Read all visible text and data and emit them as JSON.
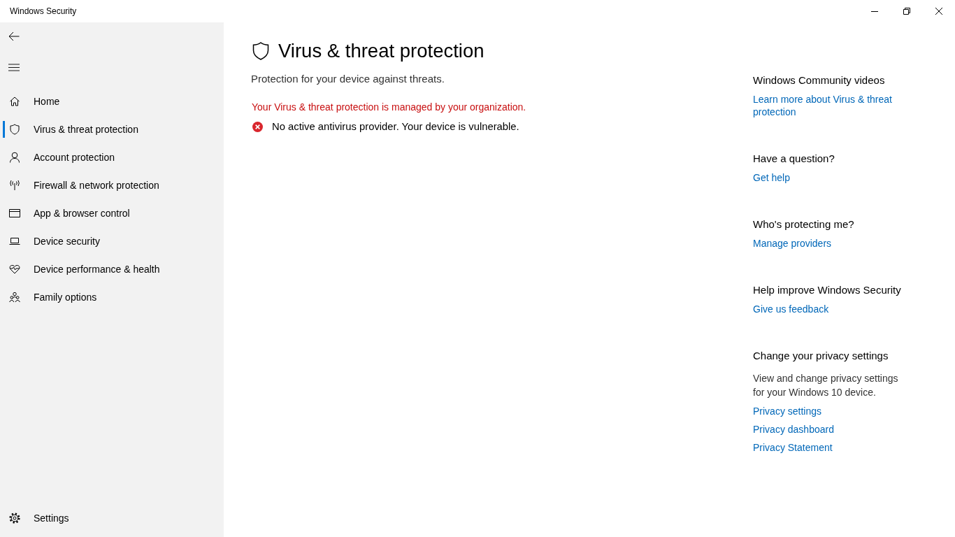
{
  "window": {
    "title": "Windows Security"
  },
  "sidebar": {
    "items": [
      {
        "kind": "home",
        "label": "Home",
        "selected": false
      },
      {
        "kind": "shield",
        "label": "Virus & threat protection",
        "selected": true
      },
      {
        "kind": "account",
        "label": "Account protection",
        "selected": false
      },
      {
        "kind": "network",
        "label": "Firewall & network protection",
        "selected": false
      },
      {
        "kind": "browser",
        "label": "App & browser control",
        "selected": false
      },
      {
        "kind": "device",
        "label": "Device security",
        "selected": false
      },
      {
        "kind": "health",
        "label": "Device performance & health",
        "selected": false
      },
      {
        "kind": "family",
        "label": "Family options",
        "selected": false
      }
    ],
    "footer_items": [
      {
        "kind": "settings",
        "label": "Settings",
        "selected": false
      }
    ]
  },
  "page": {
    "title": "Virus & threat protection",
    "subtitle": "Protection for your device against threats.",
    "notice": "Your Virus & threat protection is managed by your organization.",
    "alerts": [
      {
        "kind": "error",
        "text": "No active antivirus provider. Your device is vulnerable."
      }
    ]
  },
  "side_panel": {
    "sections": [
      {
        "heading": "Windows Community videos",
        "links": [
          "Learn more about Virus & threat protection"
        ]
      },
      {
        "heading": "Have a question?",
        "links": [
          "Get help"
        ]
      },
      {
        "heading": "Who's protecting me?",
        "links": [
          "Manage providers"
        ]
      },
      {
        "heading": "Help improve Windows Security",
        "links": [
          "Give us feedback"
        ]
      },
      {
        "heading": "Change your privacy settings",
        "description": "View and change privacy settings for your Windows 10 device.",
        "links": [
          "Privacy settings",
          "Privacy dashboard",
          "Privacy Statement"
        ]
      }
    ]
  }
}
